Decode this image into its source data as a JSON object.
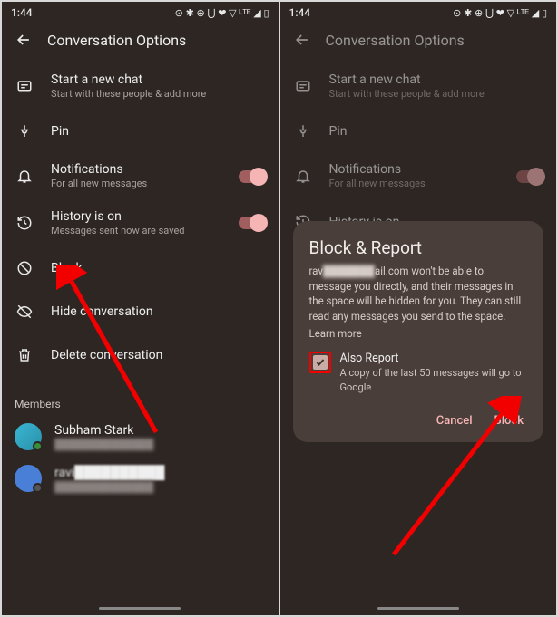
{
  "status": {
    "time": "1:44",
    "icons": "⊙ ✱ ⊕ ⋃ ❤ ▽ ᴸᵀᴱ ◢ ▯"
  },
  "header": {
    "title": "Conversation Options"
  },
  "options": {
    "newchat": {
      "title": "Start a new chat",
      "sub": "Start with these people & add more"
    },
    "pin": {
      "title": "Pin"
    },
    "notif": {
      "title": "Notifications",
      "sub": "For all new messages"
    },
    "history": {
      "title": "History is on",
      "sub": "Messages sent now are saved"
    },
    "block": {
      "title": "Block"
    },
    "hide": {
      "title": "Hide conversation"
    },
    "delete": {
      "title": "Delete conversation"
    }
  },
  "members": {
    "label": "Members",
    "m1": {
      "name": "Subham Stark",
      "sub": "██████████████"
    },
    "m2": {
      "name": "ravi██████████",
      "sub": "██████████████"
    }
  },
  "dialog": {
    "title": "Block & Report",
    "body_pre": "rav",
    "body_mid": "ail.com won't be able to message you directly, and their messages in the space will be hidden for you. They can still read any messages you send to the space.",
    "learn": "Learn more",
    "also_report": "Also Report",
    "also_sub": "A copy of the last 50 messages will go to Google",
    "cancel": "Cancel",
    "block": "Block"
  }
}
